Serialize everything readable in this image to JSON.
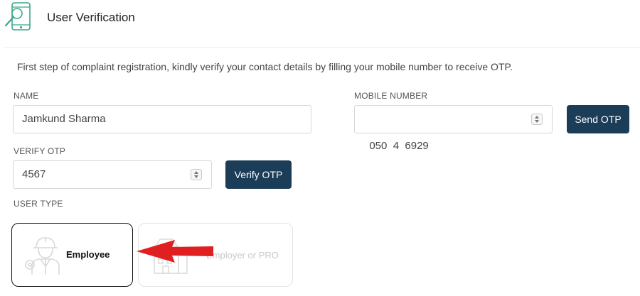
{
  "header": {
    "title": "User Verification",
    "icon": "mobile-search-icon"
  },
  "intro": "First step of complaint registration, kindly verify your contact details by filling your mobile number to receive OTP.",
  "form": {
    "name": {
      "label": "NAME",
      "value": "Jamkund Sharma"
    },
    "mobile": {
      "label": "MOBILE NUMBER",
      "value": "050  4  6929"
    },
    "send_otp_label": "Send OTP",
    "otp": {
      "label": "VERIFY OTP",
      "value": "4567"
    },
    "verify_otp_label": "Verify OTP"
  },
  "user_type": {
    "label": "USER TYPE",
    "options": [
      {
        "label": "Employee",
        "icon": "worker-helmet-icon",
        "selected": true
      },
      {
        "label": "Employer or PRO",
        "icon": "building-icon",
        "selected": false
      }
    ]
  },
  "annotation": {
    "arrow_color": "#e02020"
  },
  "colors": {
    "button": "#1c3d57",
    "header_icon": "#3aa88a"
  }
}
